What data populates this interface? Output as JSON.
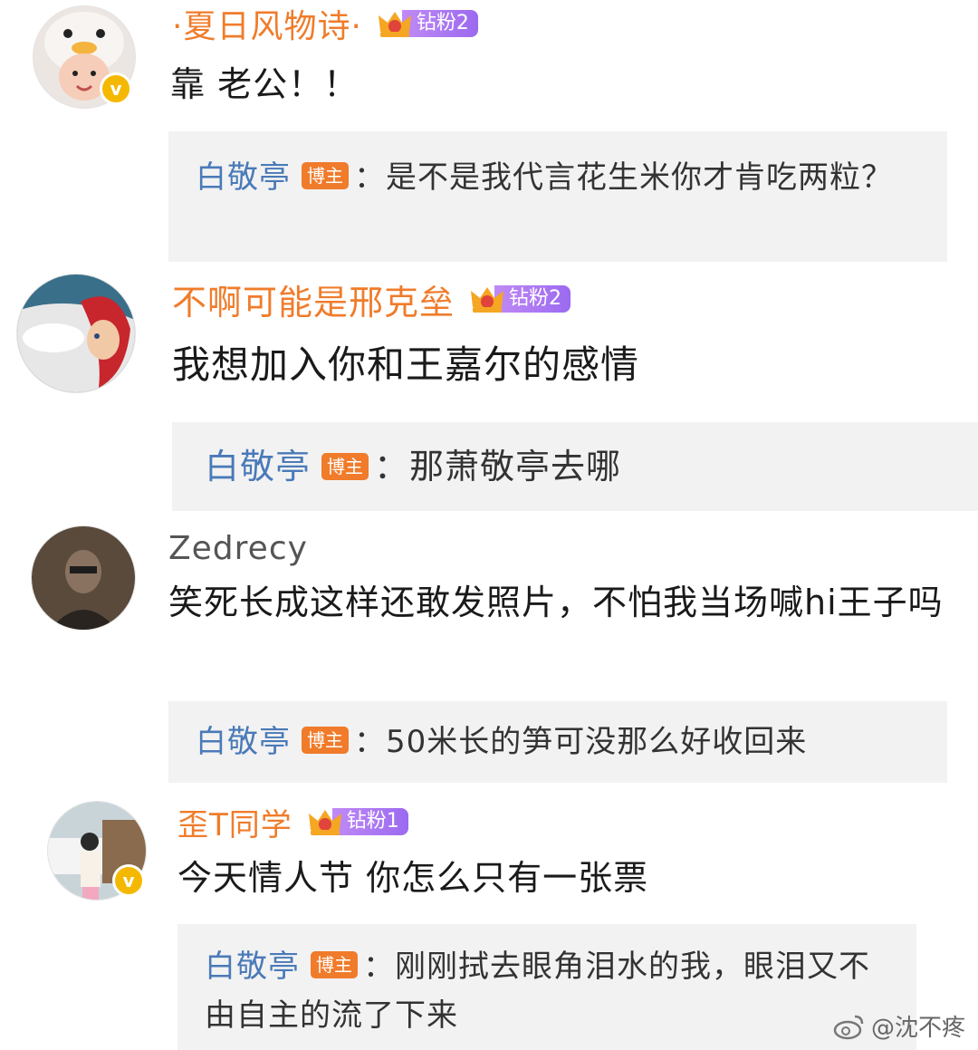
{
  "comments": [
    {
      "username": "·夏日风物诗·",
      "fan_badge": "钻粉2",
      "content": "靠 老公！！",
      "reply": {
        "user": "白敬亭",
        "badge": "博主",
        "text": "：是不是我代言花生米你才肯吃两粒？"
      }
    },
    {
      "username": "不啊可能是邢克垒",
      "fan_badge": "钻粉2",
      "content": "我想加入你和王嘉尔的感情",
      "reply": {
        "user": "白敬亭",
        "badge": "博主",
        "text": "：那萧敬亭去哪"
      }
    },
    {
      "username": "Zedrecy",
      "content": "笑死长成这样还敢发照片，不怕我当场喊hi王子吗",
      "reply": {
        "user": "白敬亭",
        "badge": "博主",
        "text": "：50米长的笋可没那么好收回来"
      }
    },
    {
      "username": "歪T同学",
      "fan_badge": "钻粉1",
      "content": "今天情人节 你怎么只有一张票",
      "reply": {
        "user": "白敬亭",
        "badge": "博主",
        "text": "：刚刚拭去眼角泪水的我，眼泪又不由自主的流了下来"
      }
    }
  ],
  "watermark": "@沈不疼",
  "colors": {
    "username": "#f07c2b",
    "reply_user": "#4a7ab8",
    "host_badge": "#f07b2a",
    "fan_pill": "#9b6af0",
    "reply_bg": "#f2f2f2"
  }
}
